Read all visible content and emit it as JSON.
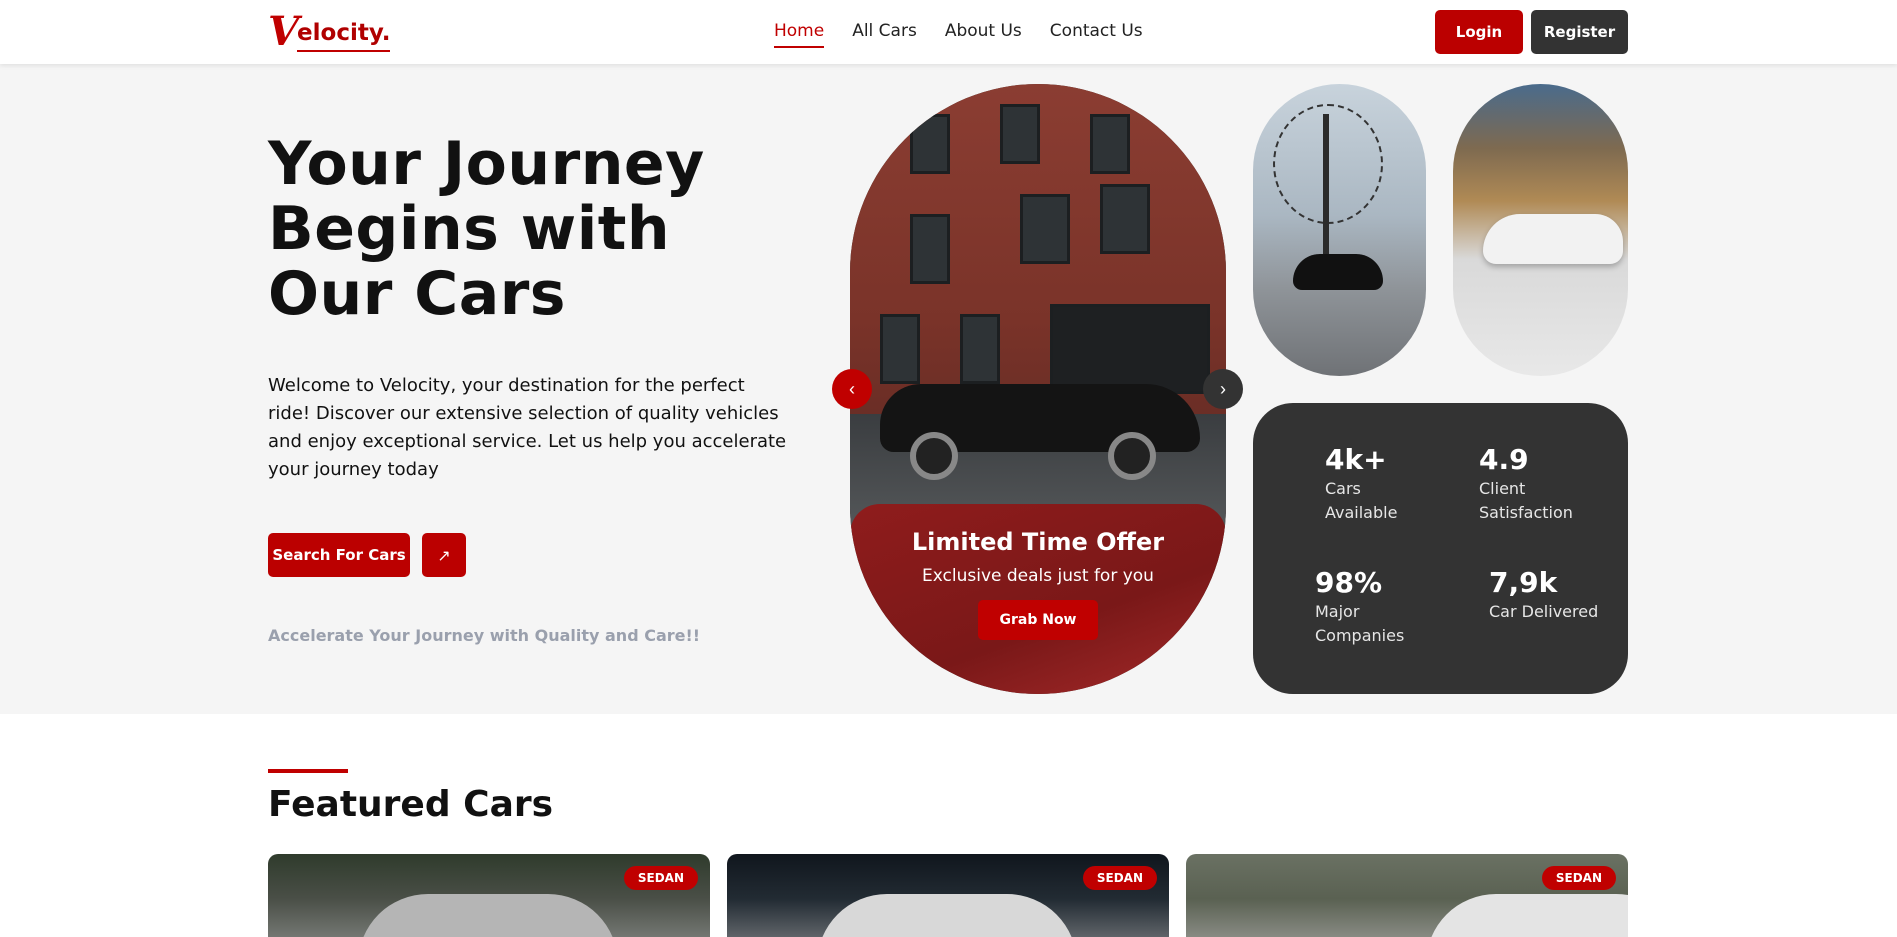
{
  "brand": {
    "logo_initial": "V",
    "logo_rest": "elocity."
  },
  "nav": {
    "links": [
      "Home",
      "All Cars",
      "About Us",
      "Contact Us"
    ],
    "login": "Login",
    "register": "Register"
  },
  "hero": {
    "title_lines": [
      "Your Journey",
      "Begins with",
      "Our Cars"
    ],
    "description": "Welcome to Velocity, your destination for the perfect ride! Discover our extensive selection of quality vehicles and enjoy exceptional service. Let us help you accelerate your journey today",
    "search_button": "Search For Cars",
    "arrow_icon": "↗",
    "tagline": "Accelerate Your Journey with Quality and Care!!"
  },
  "carousel": {
    "offer_title": "Limited Time Offer",
    "offer_subtitle": "Exclusive deals just for you",
    "offer_button": "Grab Now",
    "prev_icon": "‹",
    "next_icon": "›"
  },
  "stats": [
    {
      "value": "4k+",
      "label": "Cars Available"
    },
    {
      "value": "4.9",
      "label": "Client Satisfaction"
    },
    {
      "value": "98%",
      "label": "Major Companies"
    },
    {
      "value": "7,9k",
      "label": "Car Delivered"
    }
  ],
  "featured": {
    "title": "Featured Cars",
    "cards": [
      {
        "badge": "SEDAN"
      },
      {
        "badge": "SEDAN"
      },
      {
        "badge": "SEDAN"
      }
    ]
  },
  "colors": {
    "accent": "#c00000",
    "dark": "#333333",
    "hero_bg": "#f5f5f5"
  }
}
